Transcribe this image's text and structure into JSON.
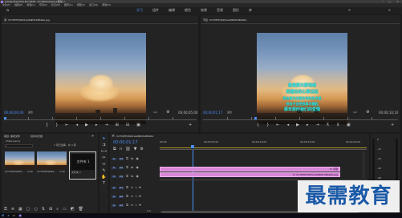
{
  "window": {
    "title": "Adobe Premiere Pro 2020 - D:\\15DA.prproj [更改] *"
  },
  "menu": [
    "文件(F)",
    "编辑(E)",
    "剪辑(C)",
    "序列(S)",
    "标记(M)",
    "图形(G)",
    "视图(V)",
    "窗口(W)",
    "帮助(H)"
  ],
  "workspaces": [
    "学习",
    "组件",
    "编辑",
    "颜色",
    "效果",
    "音频",
    "图形",
    "库"
  ],
  "source_monitor": {
    "title": "源: VCTMHFQ8W1GA8NM19E62RA.jpg",
    "timecode": "00;00;00;00",
    "fit": "适合",
    "fraction": "1/2",
    "duration": "00;00;05;00"
  },
  "program_monitor": {
    "title": "节目: VCTMHFQ8W1GA8NM19E62RA",
    "timecode": "00;00;01;17",
    "fit": "适合",
    "fraction": "1/2",
    "duration": "00;00;10;10",
    "overlay_lines": [
      "像是那天那场雨",
      "把遗忘的心事泛起",
      "我会再次出现在你的生命里",
      "你会不会把我再次想起",
      "那年那时我们的爱情"
    ]
  },
  "project_panel": {
    "tabs": [
      "项目: 素材文件",
      "媒体浏览器"
    ],
    "filename": "15DA.prproj",
    "count": "1 项已选择，共 3 项",
    "items": [
      {
        "name": "VCTMHFQ8W1...",
        "duration": "5;00"
      },
      {
        "name": "VCTMHFQ8W1...",
        "duration": "5;00"
      },
      {
        "name": "文件夹 1",
        "duration": ""
      }
    ]
  },
  "timeline": {
    "tab": "VCTMHFQ8W1GA8NM19E62RA",
    "timecode": "00;00;01;17",
    "ruler": [
      "00;00",
      "00;00;05;00",
      "00;00;10;00",
      "00;00;15;00",
      "00;00;20;00"
    ],
    "video_tracks": [
      "V3",
      "V2",
      "V1"
    ],
    "audio_tracks": [
      "A1",
      "A2",
      "A3"
    ],
    "clip_v2": "fx 字幕",
    "clip_v1": "fx VCTMHFQ8W1GA8NM19E62RA.jpg",
    "audio_zero": "0.0"
  },
  "meters": {
    "labels": [
      "0",
      "-12",
      "-24",
      "-36",
      "-48",
      "dB"
    ]
  },
  "watermark": "最需教育"
}
